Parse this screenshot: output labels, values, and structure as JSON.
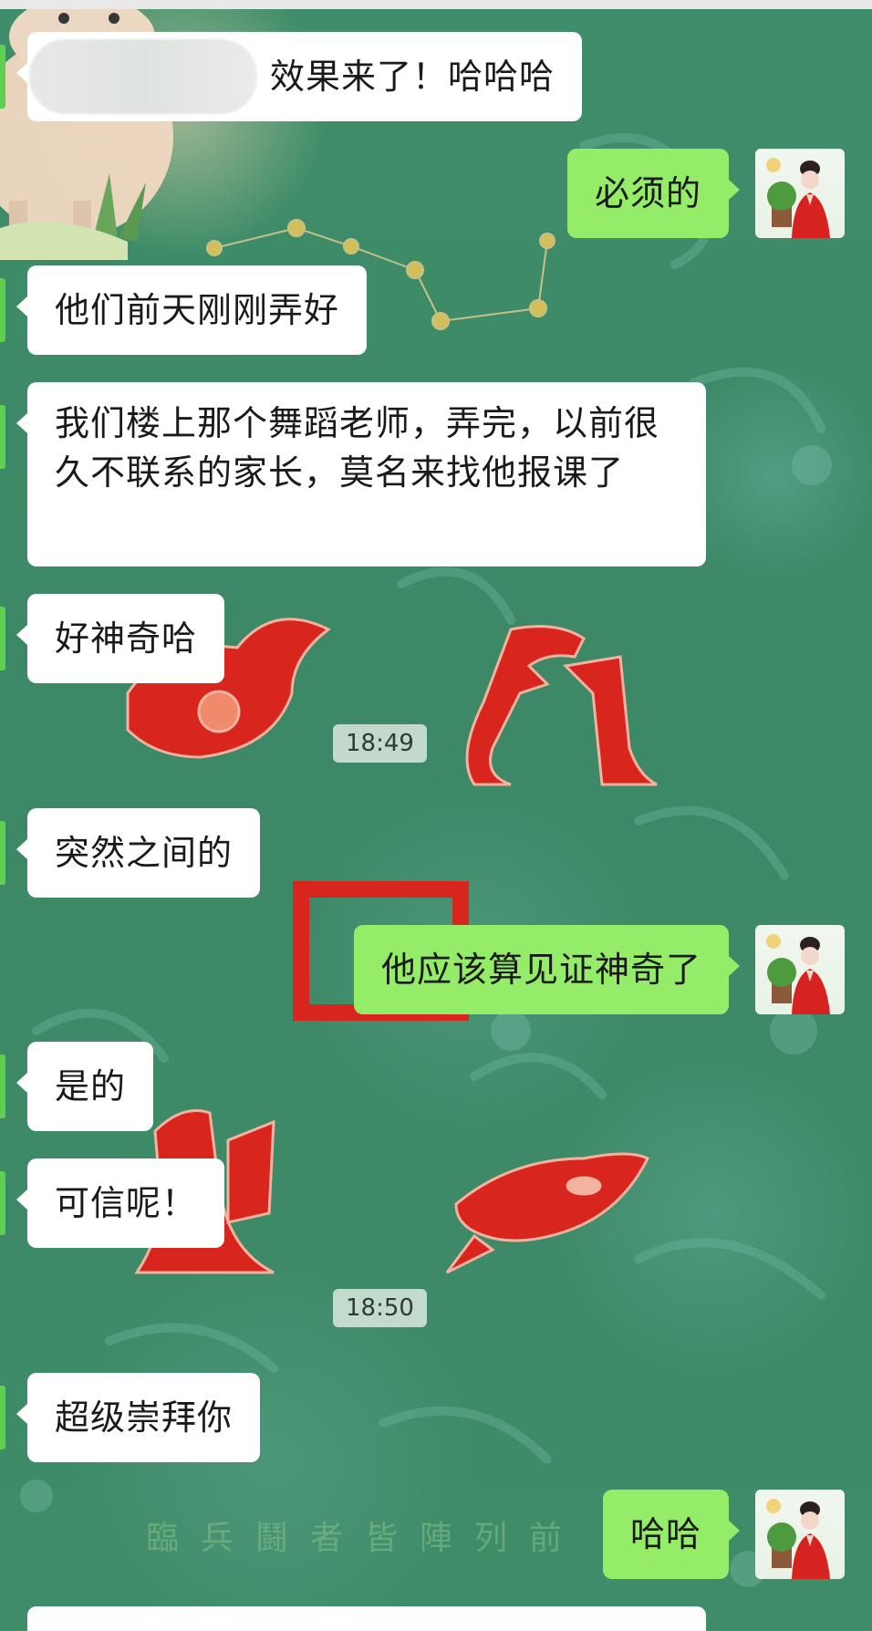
{
  "messages": [
    {
      "id": "m1",
      "side": "in",
      "text": "效果来了！哈哈哈",
      "sender_hidden": true
    },
    {
      "id": "m2",
      "side": "out",
      "text": "必须的"
    },
    {
      "id": "m3",
      "side": "in",
      "text": "他们前天刚刚弄好"
    },
    {
      "id": "m4",
      "side": "in",
      "text": "我们楼上那个舞蹈老师，弄完，以前很久不联系的家长，莫名来找他报课了"
    },
    {
      "id": "m5",
      "side": "in",
      "text": "好神奇哈"
    },
    {
      "id": "m6",
      "side": "in",
      "text": "突然之间的"
    },
    {
      "id": "m7",
      "side": "out",
      "text": "他应该算见证神奇了"
    },
    {
      "id": "m8",
      "side": "in",
      "text": "是的"
    },
    {
      "id": "m9",
      "side": "in",
      "text": "可信呢！"
    },
    {
      "id": "m10",
      "side": "in",
      "text": "超级崇拜你"
    },
    {
      "id": "m11",
      "side": "out",
      "text": "哈哈"
    }
  ],
  "timestamps": {
    "t1": "18:49",
    "t2": "18:50"
  },
  "background_text": "臨兵鬪者皆陣列前",
  "colors": {
    "incoming_bubble": "#ffffff",
    "outgoing_bubble": "#95ec69",
    "background": "#3e8a68",
    "emblem_red": "#d8261e"
  },
  "avatar_icon": "user-avatar-icon"
}
